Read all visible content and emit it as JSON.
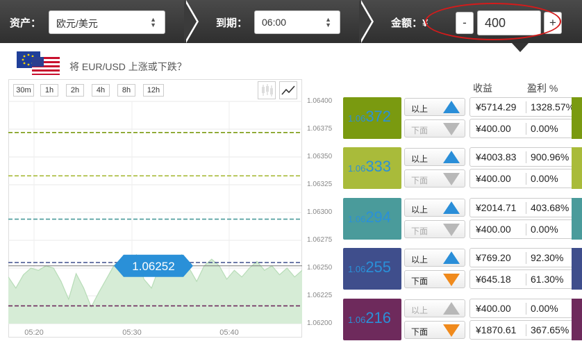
{
  "toolbar": {
    "asset_label": "资产：",
    "asset_value": "欧元/美元",
    "expiry_label": "到期：",
    "expiry_value": "06:00",
    "amount_label": "金额：¥",
    "minus_label": "-",
    "plus_label": "+",
    "amount_value": "400"
  },
  "question": "将 EUR/USD 上涨或下跌？",
  "timeframes": [
    "30m",
    "1h",
    "2h",
    "4h",
    "8h",
    "12h"
  ],
  "chart_icons": [
    "candlestick-icon",
    "line-chart-icon"
  ],
  "chart_data": {
    "type": "area",
    "y_ticks": [
      "1.06400",
      "1.06375",
      "1.06350",
      "1.06325",
      "1.06300",
      "1.06275",
      "1.06250",
      "1.06225",
      "1.06200"
    ],
    "x_ticks": [
      "05:20",
      "05:30",
      "05:40"
    ],
    "ylim": [
      1.062,
      1.064
    ],
    "current_rate_label": "1.06252",
    "current_rate": 1.06252,
    "strike_lines": [
      {
        "value": 1.06372,
        "color": "#7a9a10"
      },
      {
        "value": 1.06333,
        "color": "#a9bb3a"
      },
      {
        "value": 1.06294,
        "color": "#4a9b9b"
      },
      {
        "value": 1.06255,
        "color": "#3f4e8c"
      },
      {
        "value": 1.06216,
        "color": "#6e2a5c"
      }
    ],
    "series": [
      {
        "values": [
          1.06242,
          1.06232,
          1.06244,
          1.0625,
          1.06248,
          1.06252,
          1.0625,
          1.06238,
          1.06222,
          1.06245,
          1.06232,
          1.06215,
          1.06228,
          1.0624,
          1.06252,
          1.06258,
          1.06256,
          1.06262,
          1.0624,
          1.06232,
          1.0625,
          1.0626,
          1.06258,
          1.06262,
          1.0625,
          1.06238,
          1.06252,
          1.06258,
          1.06252,
          1.0624,
          1.06248,
          1.06242,
          1.0625,
          1.06256,
          1.06248,
          1.06252,
          1.06244,
          1.0625,
          1.06242,
          1.06248
        ]
      }
    ]
  },
  "headers": {
    "payout": "收益",
    "profit": "盈利 %"
  },
  "rows": [
    {
      "rate_base": "1.06",
      "rate_digits": "372",
      "color": "#7a9a10",
      "up_label": "以上",
      "down_label": "下面",
      "up_active": true,
      "down_active": false,
      "up_payout": "¥5714.29",
      "up_pct": "1328.57%",
      "down_payout": "¥400.00",
      "down_pct": "0.00%"
    },
    {
      "rate_base": "1.06",
      "rate_digits": "333",
      "color": "#a9bb3a",
      "up_label": "以上",
      "down_label": "下面",
      "up_active": true,
      "down_active": false,
      "up_payout": "¥4003.83",
      "up_pct": "900.96%",
      "down_payout": "¥400.00",
      "down_pct": "0.00%"
    },
    {
      "rate_base": "1.06",
      "rate_digits": "294",
      "color": "#4a9b9b",
      "up_label": "以上",
      "down_label": "下面",
      "up_active": true,
      "down_active": false,
      "up_payout": "¥2014.71",
      "up_pct": "403.68%",
      "down_payout": "¥400.00",
      "down_pct": "0.00%"
    },
    {
      "rate_base": "1.06",
      "rate_digits": "255",
      "color": "#3f4e8c",
      "up_label": "以上",
      "down_label": "下面",
      "up_active": true,
      "down_active": true,
      "up_payout": "¥769.20",
      "up_pct": "92.30%",
      "down_payout": "¥645.18",
      "down_pct": "61.30%"
    },
    {
      "rate_base": "1.06",
      "rate_digits": "216",
      "color": "#6e2a5c",
      "up_label": "以上",
      "down_label": "下面",
      "up_active": false,
      "down_active": true,
      "up_payout": "¥400.00",
      "up_pct": "0.00%",
      "down_payout": "¥1870.61",
      "down_pct": "367.65%"
    }
  ],
  "colors": {
    "up_active": "#2a8ed8",
    "down_active": "#f08a1c",
    "inactive": "#b8b8b8",
    "area_fill": "#d6ecd6",
    "area_line": "#b7dcb7",
    "rate_badge": "#2a90d8"
  }
}
